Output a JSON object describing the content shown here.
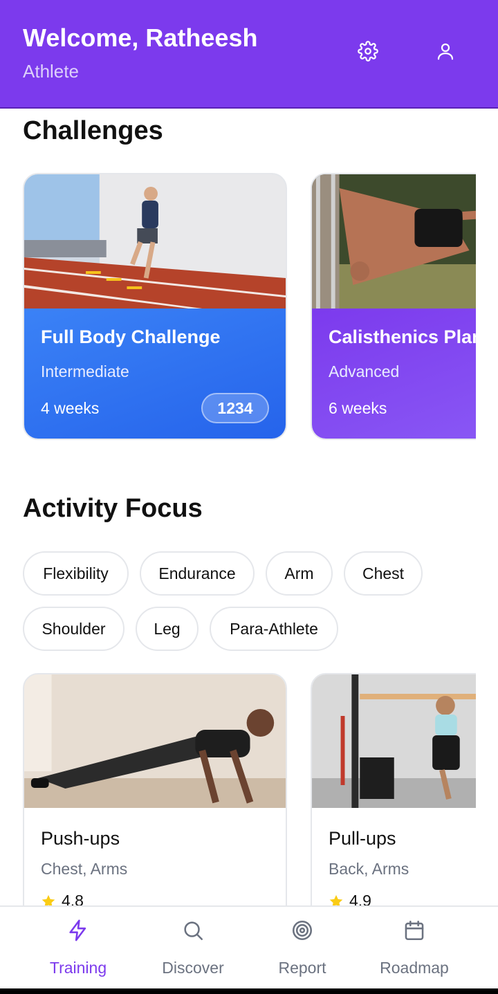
{
  "header": {
    "welcome": "Welcome, Ratheesh",
    "role": "Athlete",
    "settings_icon": "gear-icon",
    "profile_icon": "user-icon"
  },
  "challenges": {
    "title": "Challenges",
    "items": [
      {
        "name": "Full Body Challenge",
        "level": "Intermediate",
        "duration": "4 weeks",
        "count": "1234",
        "color": "#3b82f6"
      },
      {
        "name": "Calisthenics Plan",
        "level": "Advanced",
        "duration": "6 weeks",
        "color": "#7c3aed"
      }
    ]
  },
  "activity_focus": {
    "title": "Activity Focus",
    "chips": [
      "Flexibility",
      "Endurance",
      "Arm",
      "Chest",
      "Shoulder",
      "Leg",
      "Para-Athlete"
    ]
  },
  "exercises": [
    {
      "name": "Push-ups",
      "targets": "Chest, Arms",
      "rating": "4.8"
    },
    {
      "name": "Pull-ups",
      "targets": "Back, Arms",
      "rating": "4.9"
    }
  ],
  "nav": {
    "items": [
      {
        "label": "Training",
        "icon": "lightning-icon",
        "active": true
      },
      {
        "label": "Discover",
        "icon": "search-icon",
        "active": false
      },
      {
        "label": "Report",
        "icon": "target-icon",
        "active": false
      },
      {
        "label": "Roadmap",
        "icon": "calendar-icon",
        "active": false
      }
    ]
  },
  "colors": {
    "primary": "#7c3aed",
    "blue": "#3b82f6",
    "star": "#facc15"
  }
}
